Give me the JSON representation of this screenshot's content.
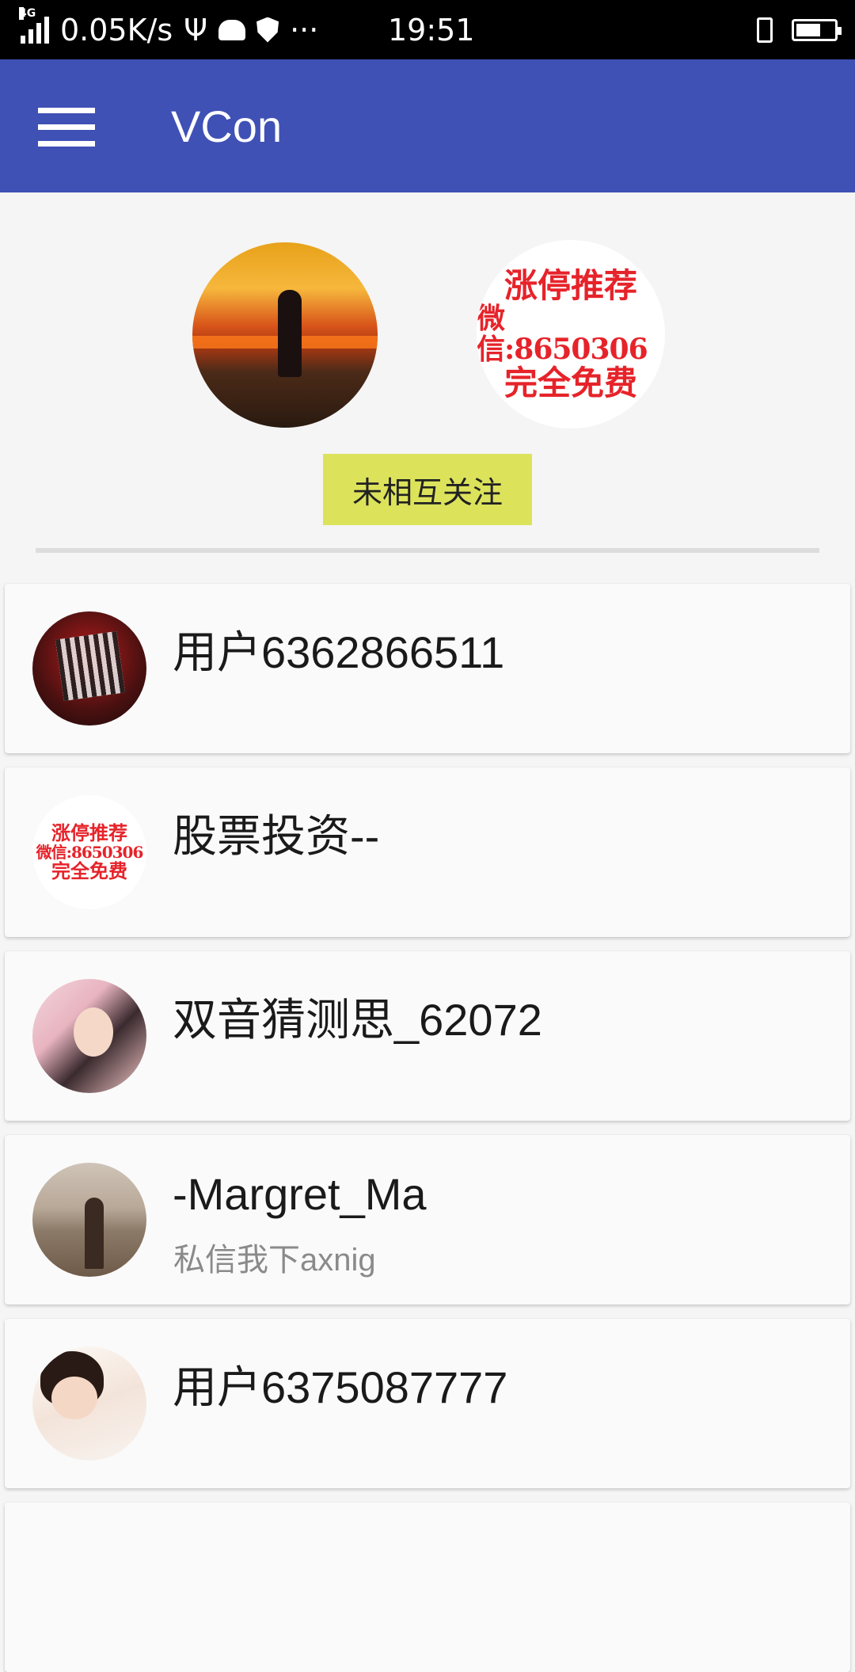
{
  "status_bar": {
    "network_type": "4G",
    "speed": "0.05K/s",
    "extra": "···",
    "time": "19:51"
  },
  "app_bar": {
    "title": "VCon",
    "menu_icon": "menu-icon"
  },
  "header": {
    "other_avatar_text": [
      "涨停推荐",
      "微信:8650306",
      "完全免费"
    ],
    "follow_status": "未相互关注"
  },
  "list": {
    "items": [
      {
        "name": "用户6362866511",
        "subtitle": "",
        "avatar_text": []
      },
      {
        "name": "股票投资--",
        "subtitle": "",
        "avatar_text": [
          "涨停推荐",
          "微信:8650306",
          "完全免费"
        ]
      },
      {
        "name": "双音猜测思_62072",
        "subtitle": ""
      },
      {
        "name": "-Margret_Ma",
        "subtitle": "私信我下axnig"
      },
      {
        "name": "用户6375087777",
        "subtitle": ""
      }
    ]
  },
  "colors": {
    "app_bar": "#3f51b5",
    "follow_badge": "#dce35b",
    "promo_text": "#e6232a"
  }
}
